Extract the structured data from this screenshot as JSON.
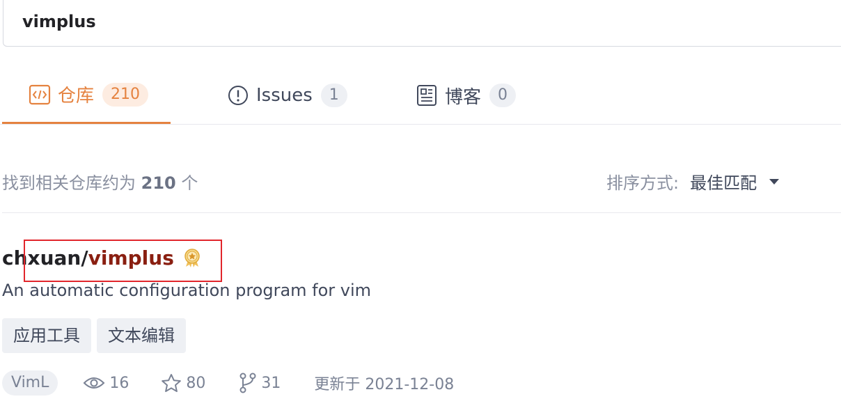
{
  "search": {
    "query": "vimplus"
  },
  "tabs": [
    {
      "label": "仓库",
      "count": "210",
      "icon": "code-icon"
    },
    {
      "label": "Issues",
      "count": "1",
      "icon": "alert-circle-icon"
    },
    {
      "label": "博客",
      "count": "0",
      "icon": "article-icon"
    }
  ],
  "results": {
    "summary_prefix": "找到相关仓库约为",
    "summary_count": "210",
    "summary_suffix": "个",
    "sort_label": "排序方式:",
    "sort_value": "最佳匹配"
  },
  "repo": {
    "owner": "chxuan",
    "separator": "/",
    "name": "vimplus",
    "badge_icon": "medal-icon",
    "description": "An automatic configuration program for vim",
    "tags": [
      "应用工具",
      "文本编辑"
    ],
    "language": "VimL",
    "watchers": "16",
    "stars": "80",
    "forks": "31",
    "updated": "更新于 2021-12-08"
  },
  "colors": {
    "accent": "#e5823f",
    "repo_name": "#8a1f11",
    "highlight": "#e1252b"
  }
}
